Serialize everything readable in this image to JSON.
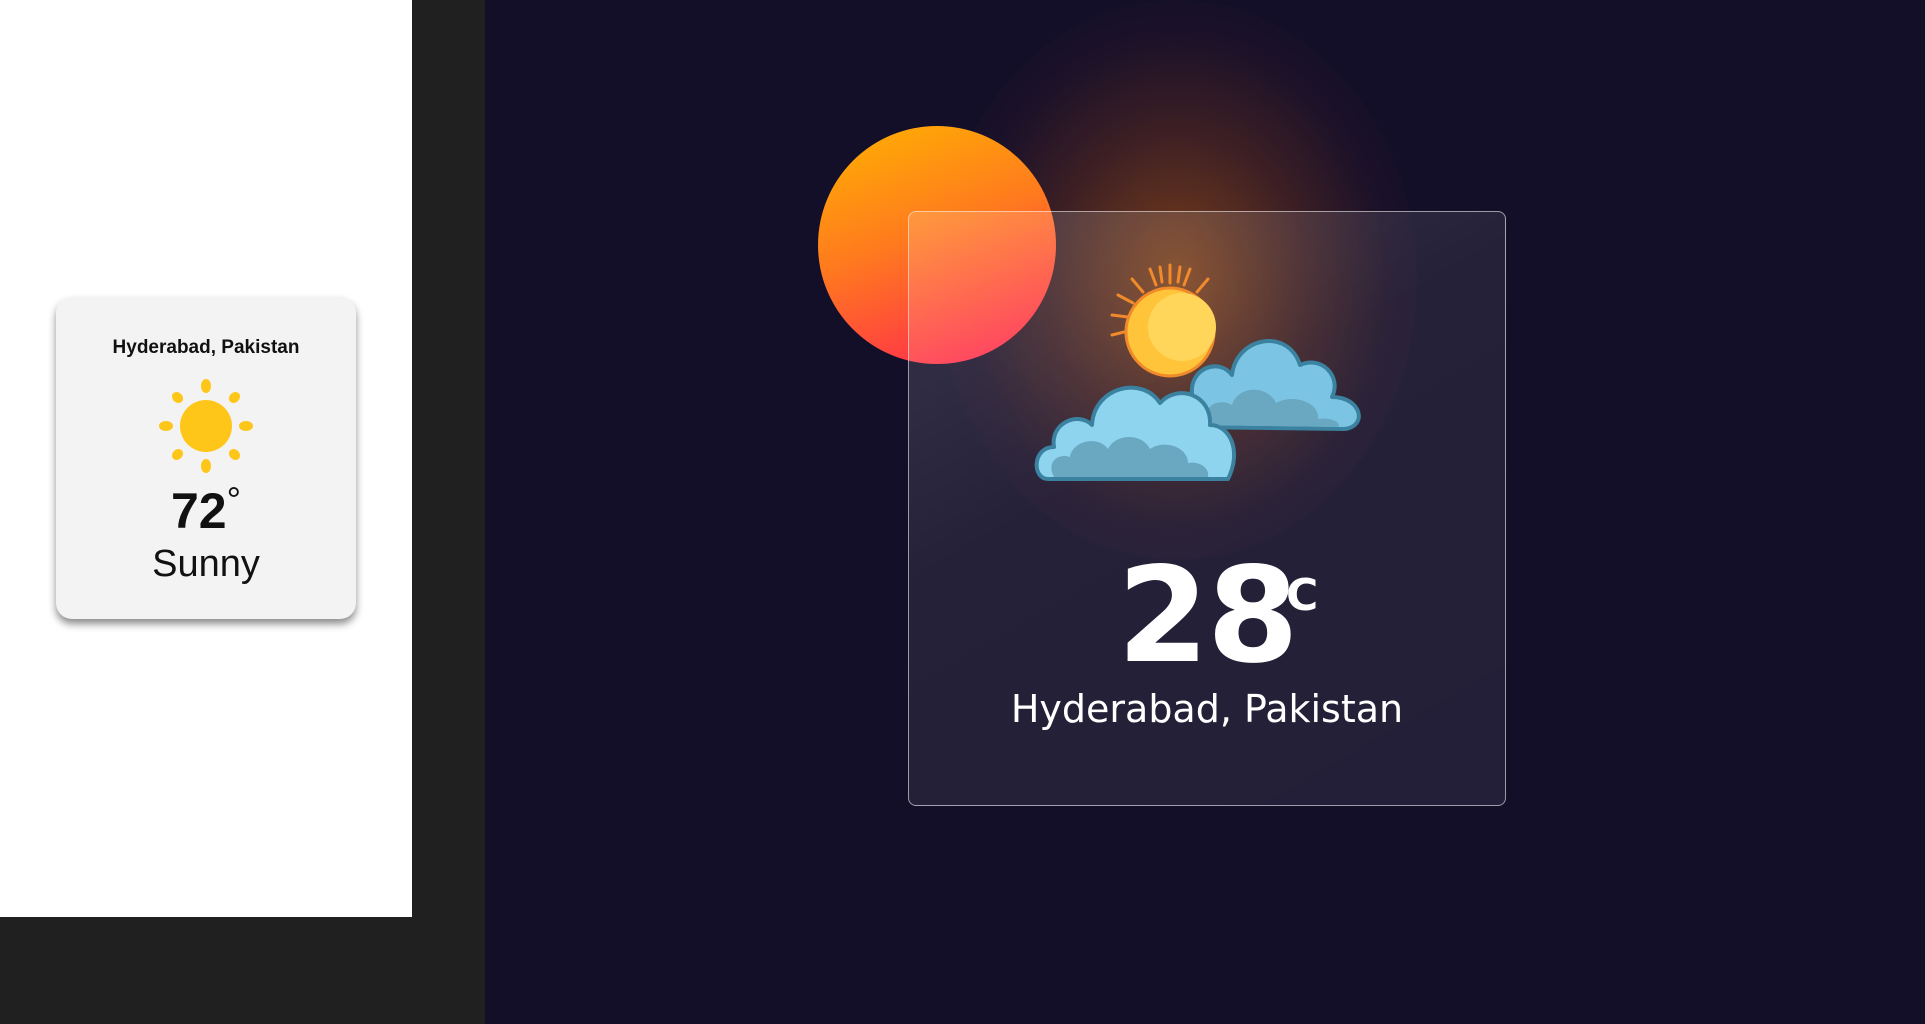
{
  "light_card": {
    "city": "Hyderabad, Pakistan",
    "icon": "sun-icon",
    "temperature": "72",
    "degree_symbol": "°",
    "condition": "Sunny"
  },
  "glass_card": {
    "icon": "partly-cloudy-icon",
    "temperature": "28",
    "unit": "°C",
    "city": "Hyderabad, Pakistan"
  },
  "colors": {
    "night_background": "#130f29",
    "sun_gradient_start": "#ffb300",
    "sun_gradient_end": "#ff1f55",
    "sunny_icon": "#ffc61a"
  }
}
